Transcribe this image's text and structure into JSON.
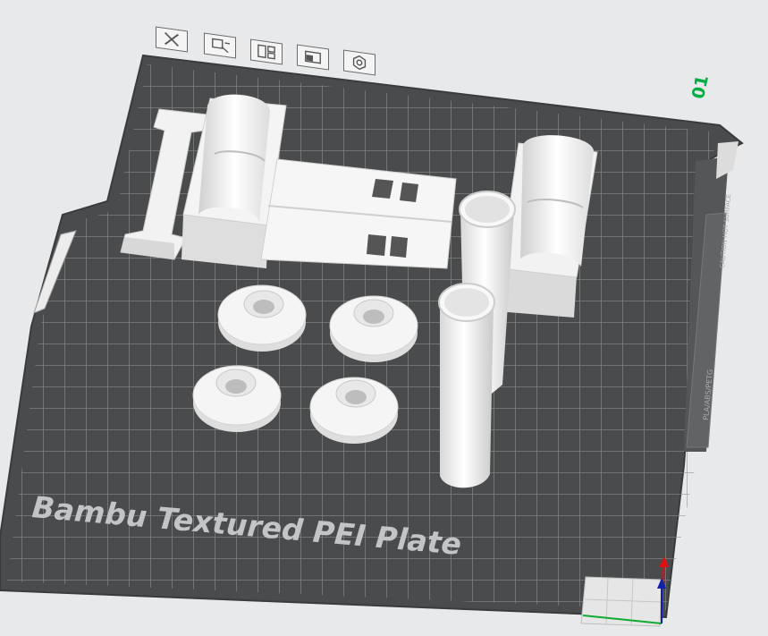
{
  "plate": {
    "number": "01",
    "label": "Bambu Textured PEI Plate",
    "side_strip_top": "CAUTION HOT SURFACE",
    "side_strip_bottom": "PLA/ABS/PETG"
  },
  "toolbar": {
    "buttons": [
      {
        "name": "delete-plate-button",
        "icon": "close-icon"
      },
      {
        "name": "arrange-plate-button",
        "icon": "arrange-icon"
      },
      {
        "name": "auto-orient-button",
        "icon": "orient-icon"
      },
      {
        "name": "lock-plate-button",
        "icon": "lock-icon"
      },
      {
        "name": "plate-settings-button",
        "icon": "gear-icon"
      }
    ]
  },
  "colors": {
    "plate": "#4a4b4c",
    "grid": "#8a8b8c",
    "model": "#f0f0f0",
    "accent": "#00ae42"
  }
}
